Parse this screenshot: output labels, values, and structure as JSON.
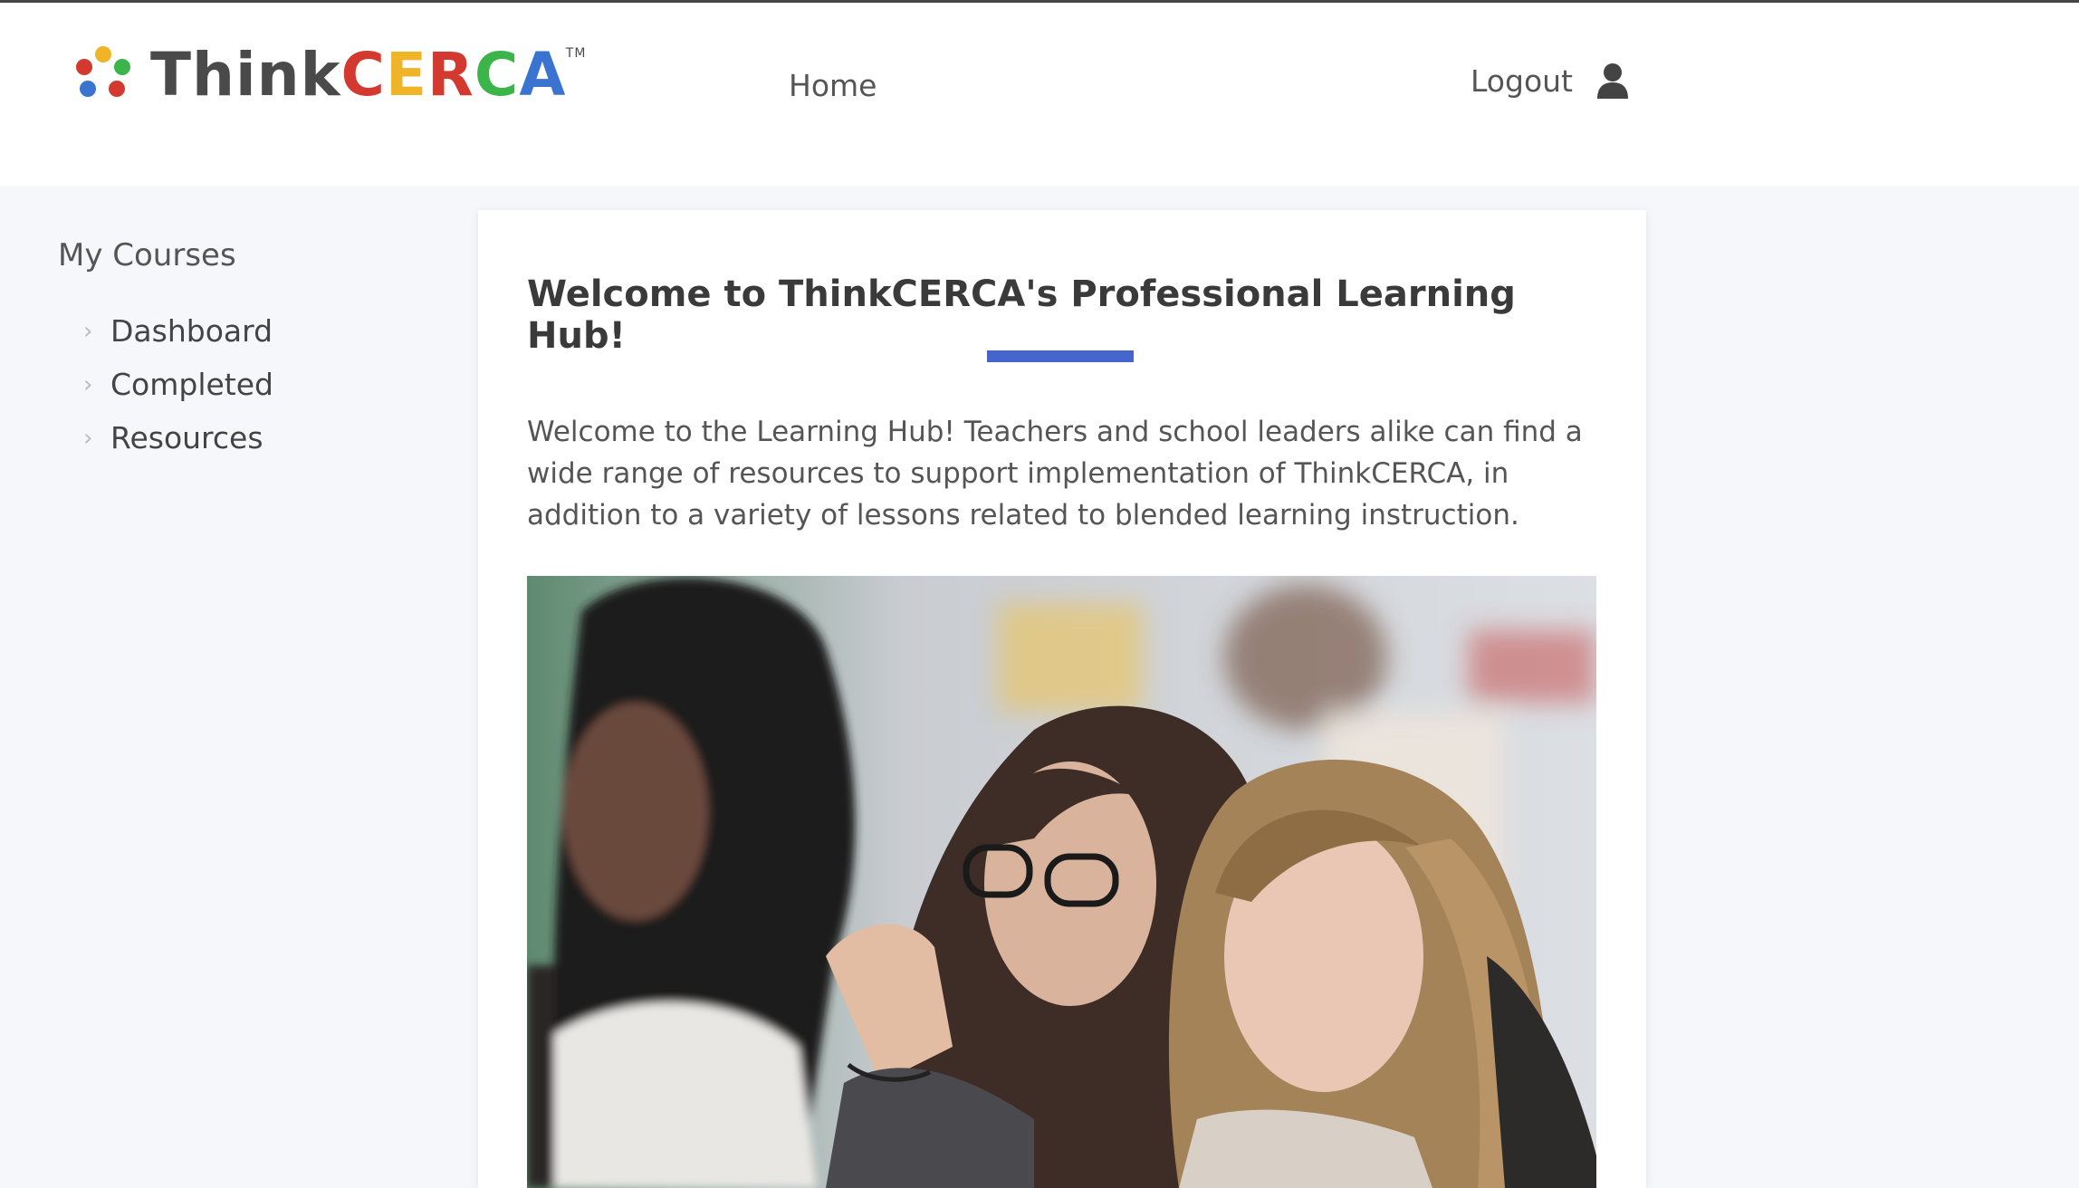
{
  "header": {
    "logo": {
      "word_think": "Think",
      "word_cerca": [
        "C",
        "E",
        "R",
        "C",
        "A"
      ],
      "cerca_colors": [
        "#d3392f",
        "#f0b429",
        "#d3392f",
        "#3bb54a",
        "#3b73d1"
      ],
      "dot_colors": [
        "#f0b429",
        "#3bb54a",
        "#d3392f",
        "#3b73d1",
        "#d3392f"
      ],
      "tm": "TM"
    },
    "nav_home": "Home",
    "nav_logout": "Logout",
    "user_icon": "user-icon"
  },
  "sidebar": {
    "title": "My Courses",
    "items": [
      {
        "label": "Dashboard"
      },
      {
        "label": "Completed"
      },
      {
        "label": "Resources"
      }
    ]
  },
  "main": {
    "title": "Welcome to ThinkCERCA's Professional Learning Hub!",
    "accent_color": "#4466cc",
    "body": "Welcome to the Learning Hub! Teachers and school leaders alike can find a wide range of resources to support implementation of ThinkCERCA, in addition to a variety of lessons related to blended learning instruction."
  }
}
